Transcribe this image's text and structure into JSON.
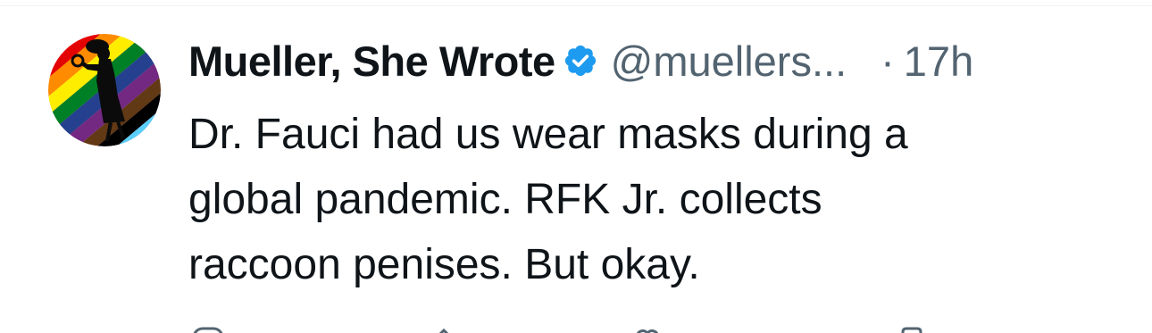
{
  "tweet": {
    "author": {
      "display_name": "Mueller, She Wrote",
      "handle": "@muellers...",
      "verified_icon": "verified-badge-icon",
      "avatar_icon": "avatar-silhouette-rainbow"
    },
    "separator": "·",
    "time": "17h",
    "text_lines": [
      "Dr. Fauci had us wear masks during a",
      "global pandemic. RFK Jr. collects",
      "raccoon penises. But okay."
    ],
    "actions": [
      {
        "icon": "reply-icon"
      },
      {
        "icon": "repost-icon"
      },
      {
        "icon": "like-icon"
      },
      {
        "icon": "views-icon"
      }
    ]
  },
  "colors": {
    "text_primary": "#0f1419",
    "text_secondary": "#536471",
    "verified_blue": "#1d9bf0"
  }
}
